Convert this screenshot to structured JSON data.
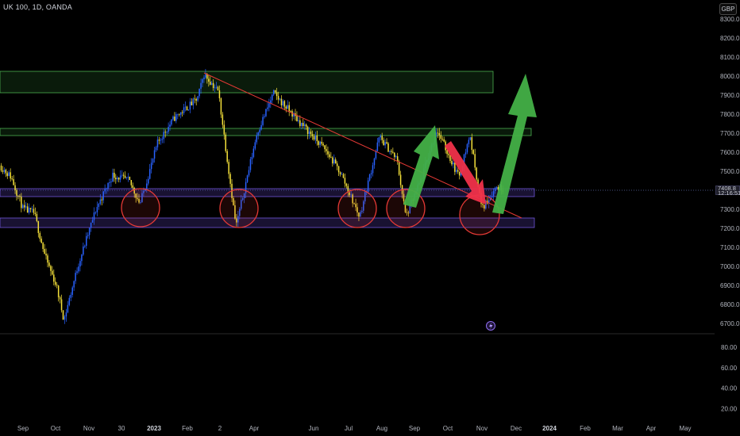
{
  "chart_header": {
    "symbol_line": "UK 100, 1D, OANDA"
  },
  "currency_badge": "GBP",
  "price_axis": {
    "ticks": [
      "8300.0",
      "8200.0",
      "8100.0",
      "8000.0",
      "7900.0",
      "7800.0",
      "7700.0",
      "7600.0",
      "7500.0",
      "7400.0",
      "7300.0",
      "7200.0",
      "7100.0",
      "7000.0",
      "6900.0",
      "6800.0",
      "6700.0"
    ],
    "current_price": "7408.8",
    "countdown": "12:16:51"
  },
  "indicator_axis": {
    "ticks": [
      "80.00",
      "60.00",
      "40.00",
      "20.00"
    ]
  },
  "time_axis": {
    "ticks": [
      {
        "label": "Sep",
        "bold": false
      },
      {
        "label": "Oct",
        "bold": false
      },
      {
        "label": "Nov",
        "bold": false
      },
      {
        "label": "30",
        "bold": false
      },
      {
        "label": "2023",
        "bold": true
      },
      {
        "label": "Feb",
        "bold": false
      },
      {
        "label": "2",
        "bold": false
      },
      {
        "label": "Apr",
        "bold": false
      },
      {
        "label": "Jun",
        "bold": false
      },
      {
        "label": "Jul",
        "bold": false
      },
      {
        "label": "Aug",
        "bold": false
      },
      {
        "label": "Sep",
        "bold": false
      },
      {
        "label": "Oct",
        "bold": false
      },
      {
        "label": "Nov",
        "bold": false
      },
      {
        "label": "Dec",
        "bold": false
      },
      {
        "label": "2024",
        "bold": true
      },
      {
        "label": "Feb",
        "bold": false
      },
      {
        "label": "Mar",
        "bold": false
      },
      {
        "label": "Apr",
        "bold": false
      },
      {
        "label": "May",
        "bold": false
      }
    ]
  },
  "colors": {
    "bull_candle": "#2962ff",
    "bear_candle": "#f5e13a",
    "support_zone": "#5b3fb5",
    "resistance_zone": "#2e7d32",
    "trendline": "#e53935",
    "circle": "#e53935",
    "arrow_up": "#43b047",
    "arrow_down": "#f0324a"
  },
  "chart_data": {
    "type": "candlestick",
    "symbol": "UK 100",
    "interval": "1D",
    "source": "OANDA",
    "currency": "GBP",
    "ylim": [
      6650,
      8350
    ],
    "last_price": 7408.8,
    "price_path": [
      {
        "date": "2022-08-15",
        "close": 7530
      },
      {
        "date": "2022-08-25",
        "close": 7470
      },
      {
        "date": "2022-09-05",
        "close": 7300
      },
      {
        "date": "2022-09-15",
        "close": 7280
      },
      {
        "date": "2022-09-25",
        "close": 7050
      },
      {
        "date": "2022-10-05",
        "close": 6900
      },
      {
        "date": "2022-10-12",
        "close": 6720
      },
      {
        "date": "2022-10-25",
        "close": 7010
      },
      {
        "date": "2022-11-10",
        "close": 7300
      },
      {
        "date": "2022-11-25",
        "close": 7480
      },
      {
        "date": "2022-12-10",
        "close": 7450
      },
      {
        "date": "2022-12-20",
        "close": 7330
      },
      {
        "date": "2023-01-05",
        "close": 7650
      },
      {
        "date": "2023-01-20",
        "close": 7780
      },
      {
        "date": "2023-02-10",
        "close": 7880
      },
      {
        "date": "2023-02-16",
        "close": 8010
      },
      {
        "date": "2023-03-01",
        "close": 7920
      },
      {
        "date": "2023-03-17",
        "close": 7210
      },
      {
        "date": "2023-04-05",
        "close": 7700
      },
      {
        "date": "2023-04-20",
        "close": 7910
      },
      {
        "date": "2023-05-15",
        "close": 7750
      },
      {
        "date": "2023-06-05",
        "close": 7620
      },
      {
        "date": "2023-06-20",
        "close": 7490
      },
      {
        "date": "2023-07-07",
        "close": 7260
      },
      {
        "date": "2023-07-25",
        "close": 7680
      },
      {
        "date": "2023-08-10",
        "close": 7560
      },
      {
        "date": "2023-08-18",
        "close": 7260
      },
      {
        "date": "2023-09-01",
        "close": 7460
      },
      {
        "date": "2023-09-15",
        "close": 7720
      },
      {
        "date": "2023-10-05",
        "close": 7470
      },
      {
        "date": "2023-10-15",
        "close": 7690
      },
      {
        "date": "2023-10-26",
        "close": 7300
      },
      {
        "date": "2023-11-08",
        "close": 7420
      },
      {
        "date": "2023-11-15",
        "close": 7408.8
      }
    ],
    "zones": [
      {
        "kind": "resistance",
        "from": 7920,
        "to": 8030
      },
      {
        "kind": "resistance",
        "from": 7700,
        "to": 7730
      },
      {
        "kind": "support",
        "from": 7375,
        "to": 7410
      },
      {
        "kind": "support",
        "from": 7205,
        "to": 7255
      }
    ],
    "trendline": [
      {
        "date": "2023-02-16",
        "price": 8020
      },
      {
        "date": "2023-11-20",
        "price": 7290
      }
    ],
    "marked_lows": [
      "2022-12-15",
      "2023-03-17",
      "2023-07-07",
      "2023-08-18",
      "2023-10-26"
    ]
  }
}
